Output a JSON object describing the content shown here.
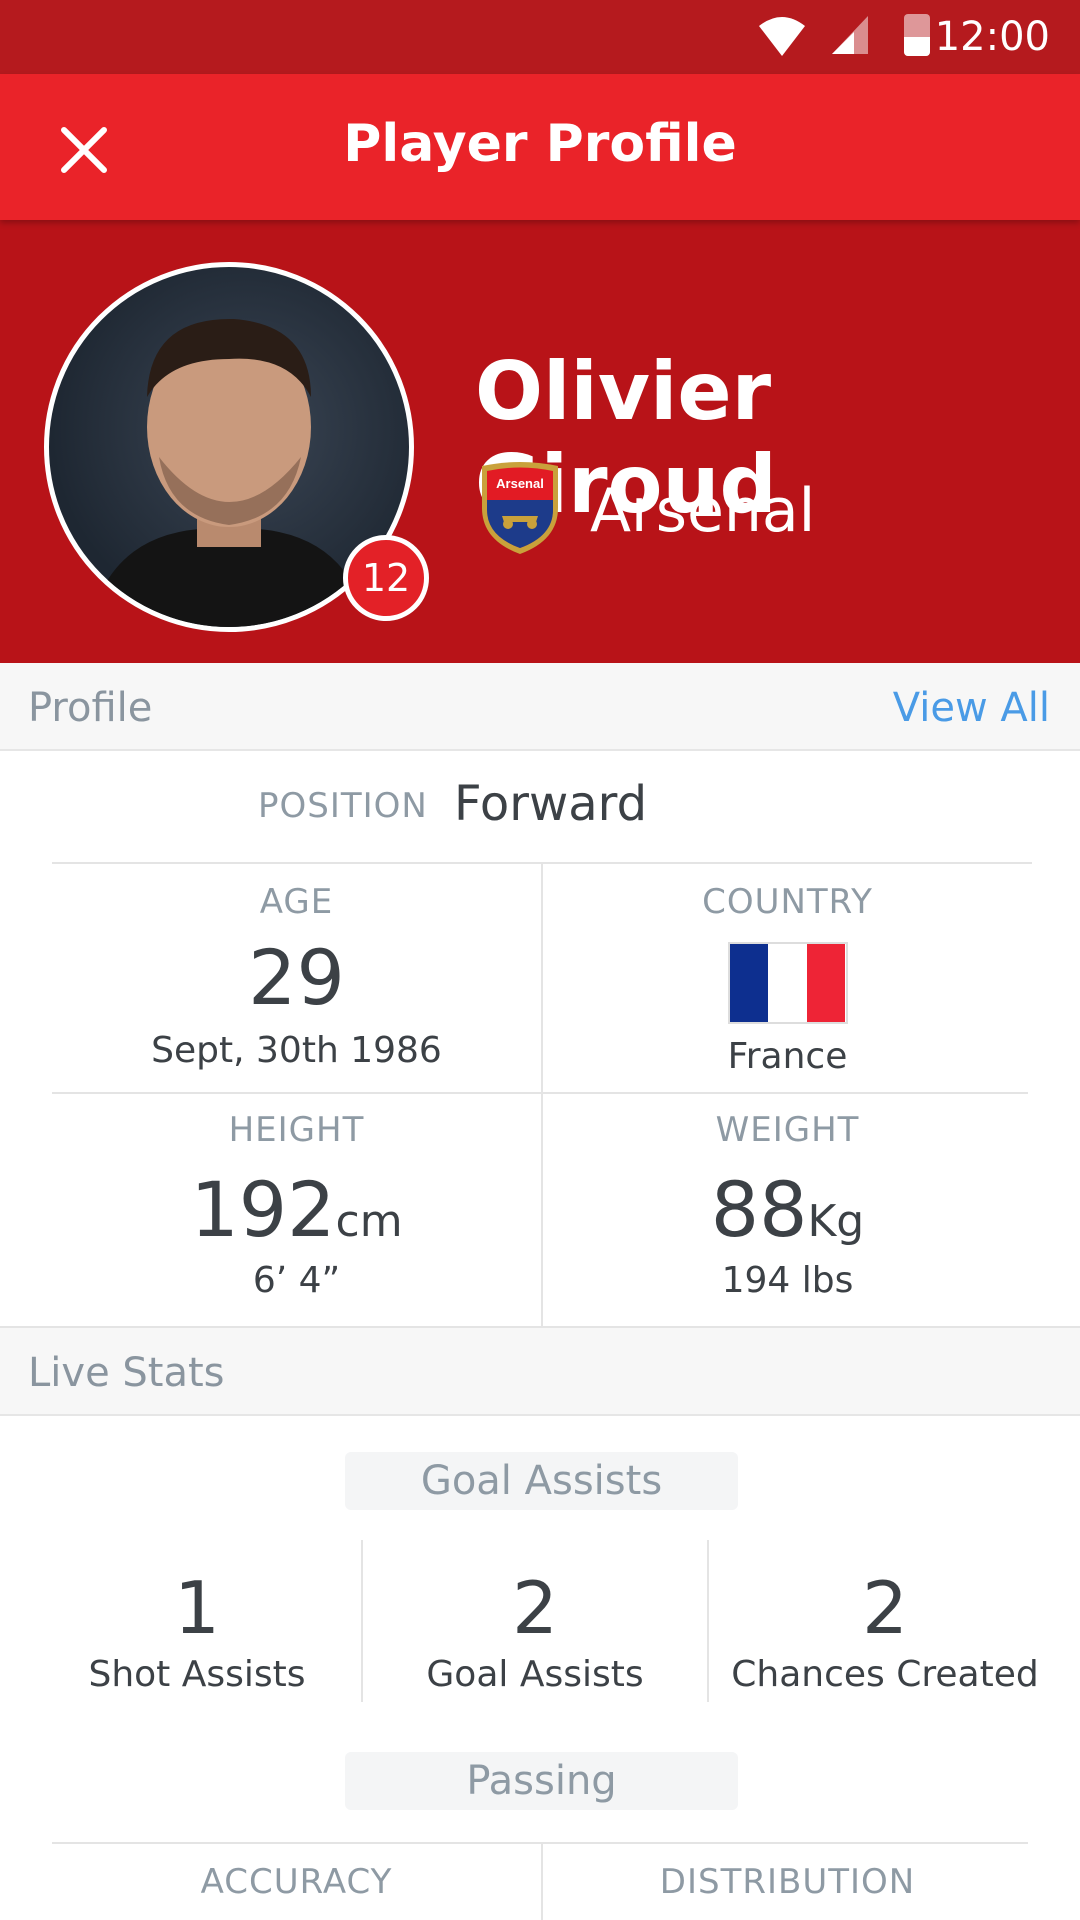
{
  "status_bar": {
    "time": "12:00"
  },
  "app_bar": {
    "title": "Player Profile"
  },
  "player": {
    "name": "Olivier Giroud",
    "number": "12",
    "club": "Arsenal",
    "crest_text": "Arsenal"
  },
  "profile_section": {
    "header": "Profile",
    "view_all": "View All",
    "position_label": "POSITION",
    "position_value": "Forward",
    "age": {
      "label": "AGE",
      "value": "29",
      "sub": "Sept, 30th 1986"
    },
    "country": {
      "label": "COUNTRY",
      "value": "France",
      "flag_colors": [
        "#0d2f8f",
        "#ffffff",
        "#ee2436"
      ]
    },
    "height": {
      "label": "HEIGHT",
      "value": "192",
      "unit": "cm",
      "sub": "6’ 4”"
    },
    "weight": {
      "label": "WEIGHT",
      "value": "88",
      "unit": "Kg",
      "sub": "194 lbs"
    }
  },
  "live_stats": {
    "header": "Live Stats",
    "goal_assists_group": {
      "title": "Goal Assists",
      "items": [
        {
          "value": "1",
          "label": "Shot Assists"
        },
        {
          "value": "2",
          "label": "Goal Assists"
        },
        {
          "value": "2",
          "label": "Chances Created"
        }
      ]
    },
    "passing_group": {
      "title": "Passing",
      "columns": [
        "ACCURACY",
        "DISTRIBUTION"
      ]
    }
  },
  "colors": {
    "status_bar": "#b51a1e",
    "app_bar": "#ea2329",
    "hero": "#b81318",
    "link": "#4a9be6"
  }
}
